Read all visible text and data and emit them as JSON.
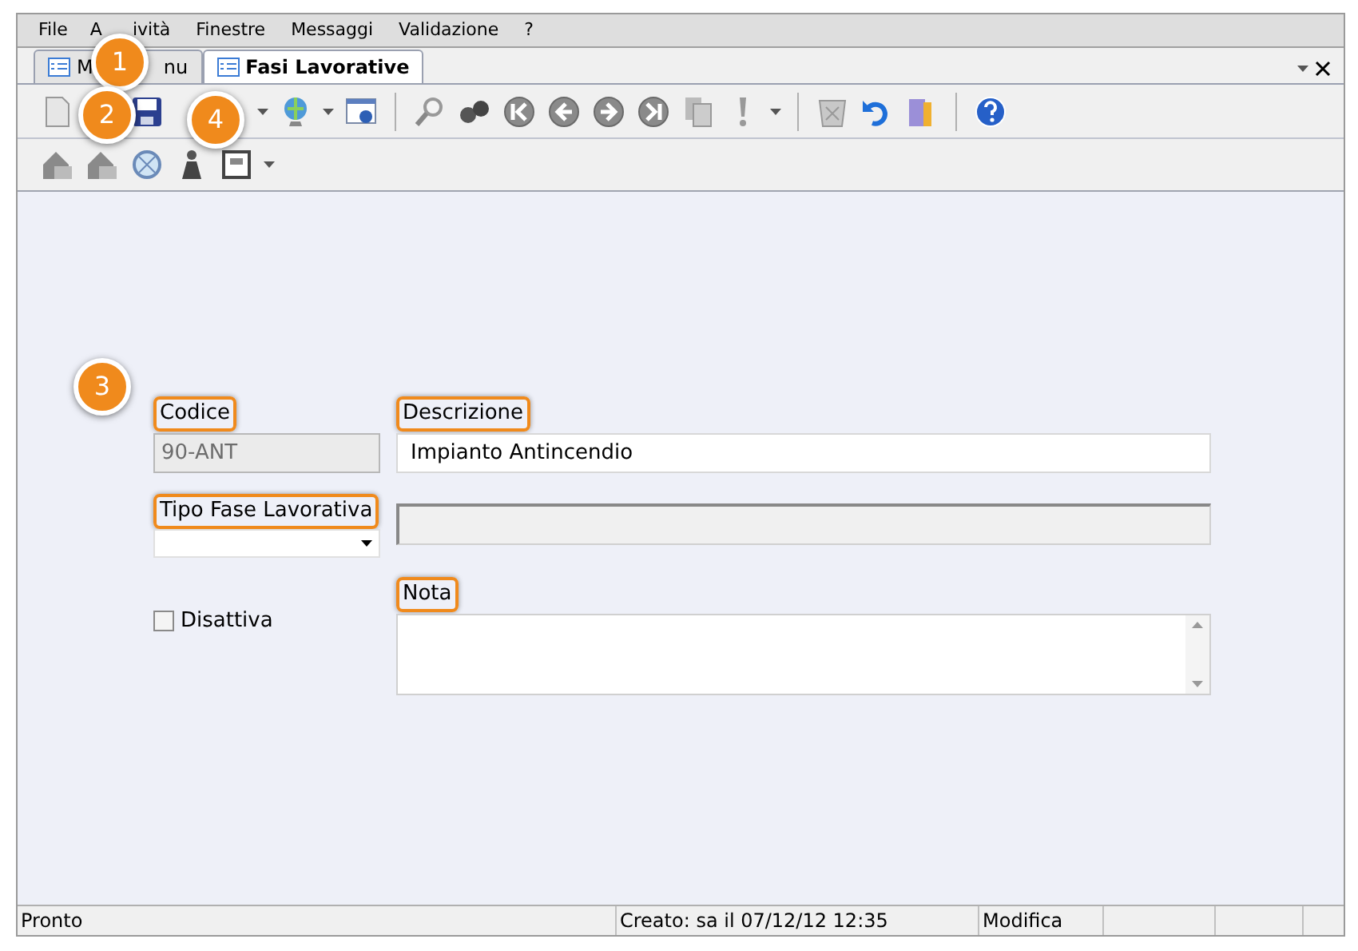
{
  "menu": [
    {
      "label": "File"
    },
    {
      "label_parts": [
        "A",
        "ività"
      ]
    },
    {
      "label": "Finestre"
    },
    {
      "label": "Messaggi"
    },
    {
      "label": "Validazione"
    },
    {
      "label": "?"
    }
  ],
  "tabs": [
    {
      "label_parts": [
        "M",
        "nu"
      ],
      "selected": false
    },
    {
      "label": "Fasi Lavorative",
      "selected": true
    }
  ],
  "form": {
    "codice": {
      "label": "Codice",
      "highlighted": true,
      "value": "90-ANT",
      "disabled": true
    },
    "descrizione": {
      "label": "Descrizione",
      "highlighted": true,
      "value": "Impianto Antincendio",
      "disabled": false
    },
    "tipo": {
      "label": "Tipo Fase Lavorativa",
      "highlighted": true
    },
    "nota": {
      "label": "Nota",
      "highlighted": true
    },
    "disattiva": {
      "label": "Disattiva",
      "checked": false
    }
  },
  "status_bar": [
    "Pronto",
    "Creato: sa il 07/12/12 12:35",
    "Modifica"
  ],
  "callouts": [
    "1",
    "2",
    "3",
    "4"
  ]
}
